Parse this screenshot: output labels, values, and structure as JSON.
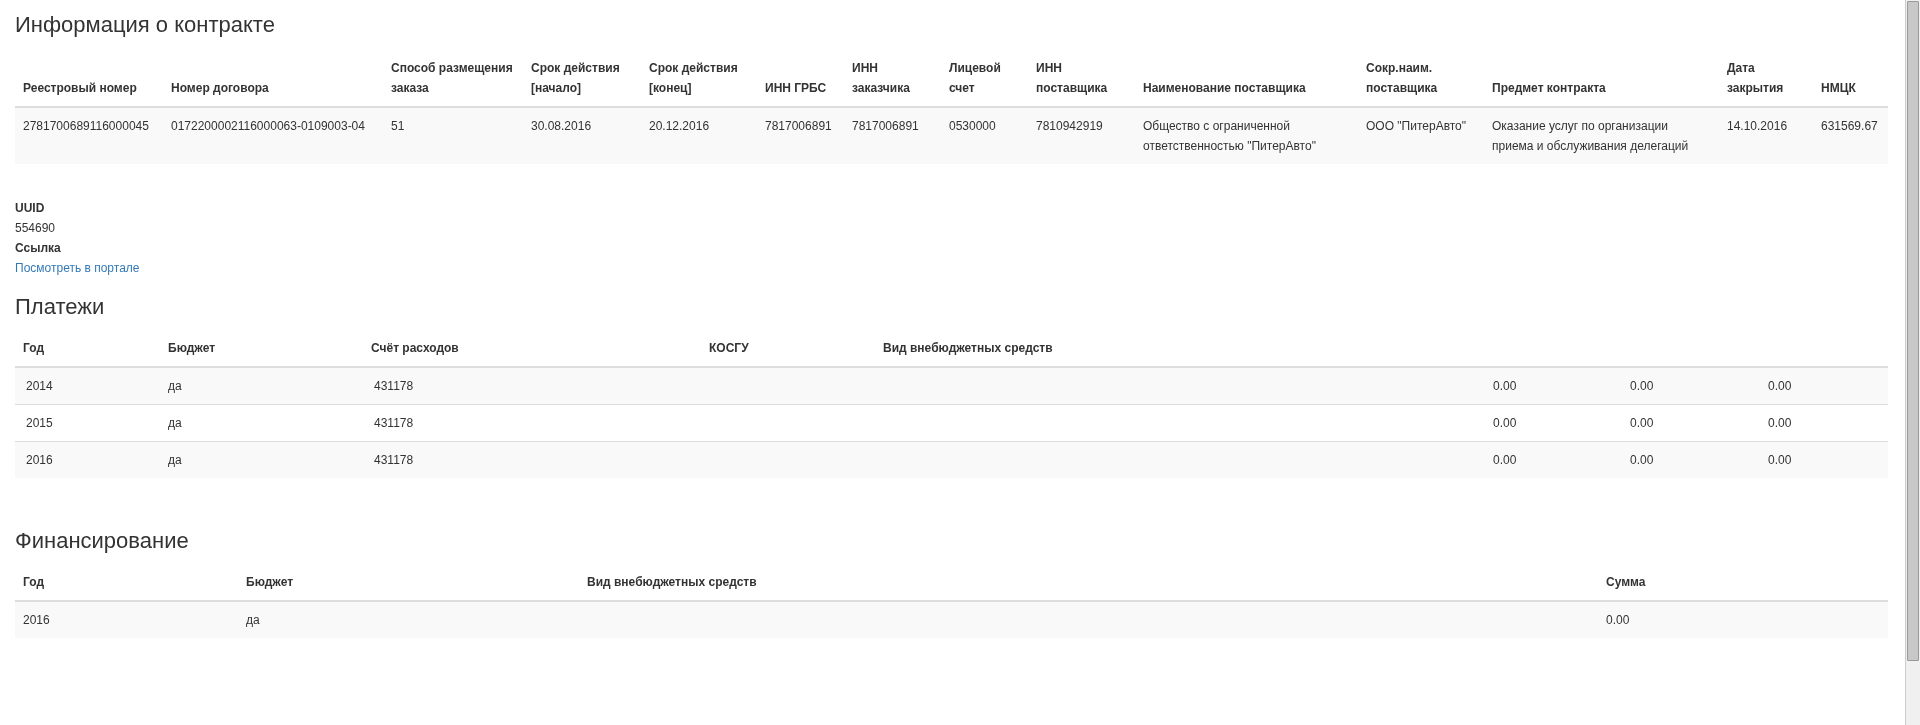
{
  "contract": {
    "title": "Информация о контракте",
    "columns": [
      "Реестровый номер",
      "Номер договора",
      "Способ размещения заказа",
      "Срок действия [начало]",
      "Срок действия [конец]",
      "ИНН ГРБС",
      "ИНН заказчика",
      "Лицевой счет",
      "ИНН поставщика",
      "Наименование поставщика",
      "Сокр.наим. поставщика",
      "Предмет контракта",
      "Дата закрытия",
      "НМЦК"
    ],
    "rows": [
      [
        "2781700689116000045",
        "0172200002116000063-0109003-04",
        "51",
        "30.08.2016",
        "20.12.2016",
        "7817006891",
        "7817006891",
        "0530000",
        "7810942919",
        "Общество с ограниченной ответственностью \"ПитерАвто\"",
        "ООО \"ПитерАвто\"",
        "Оказание услуг по организации приема и обслуживания делегаций",
        "14.10.2016",
        "631569.67"
      ]
    ]
  },
  "details": [
    {
      "label": "UUID",
      "value": "554690",
      "kind": "text"
    },
    {
      "label": "Ссылка",
      "value": "Посмотреть в портале",
      "kind": "link"
    }
  ],
  "payments": {
    "title": "Платежи",
    "columns": [
      "Год",
      "Бюджет",
      "Счёт расходов",
      "КОСГУ",
      "Вид внебюджетных средств"
    ],
    "rows": [
      {
        "year": "2014",
        "budget": "да",
        "account": "431178",
        "amounts": [
          "0.00",
          "0.00",
          "0.00"
        ]
      },
      {
        "year": "2015",
        "budget": "да",
        "account": "431178",
        "amounts": [
          "0.00",
          "0.00",
          "0.00"
        ]
      },
      {
        "year": "2016",
        "budget": "да",
        "account": "431178",
        "amounts": [
          "0.00",
          "0.00",
          "0.00"
        ]
      }
    ]
  },
  "financing": {
    "title": "Финансирование",
    "columns": [
      "Год",
      "Бюджет",
      "Вид внебюджетных средств",
      "Сумма"
    ],
    "rows": [
      {
        "year": "2016",
        "budget": "да",
        "sum": "0.00"
      }
    ]
  }
}
